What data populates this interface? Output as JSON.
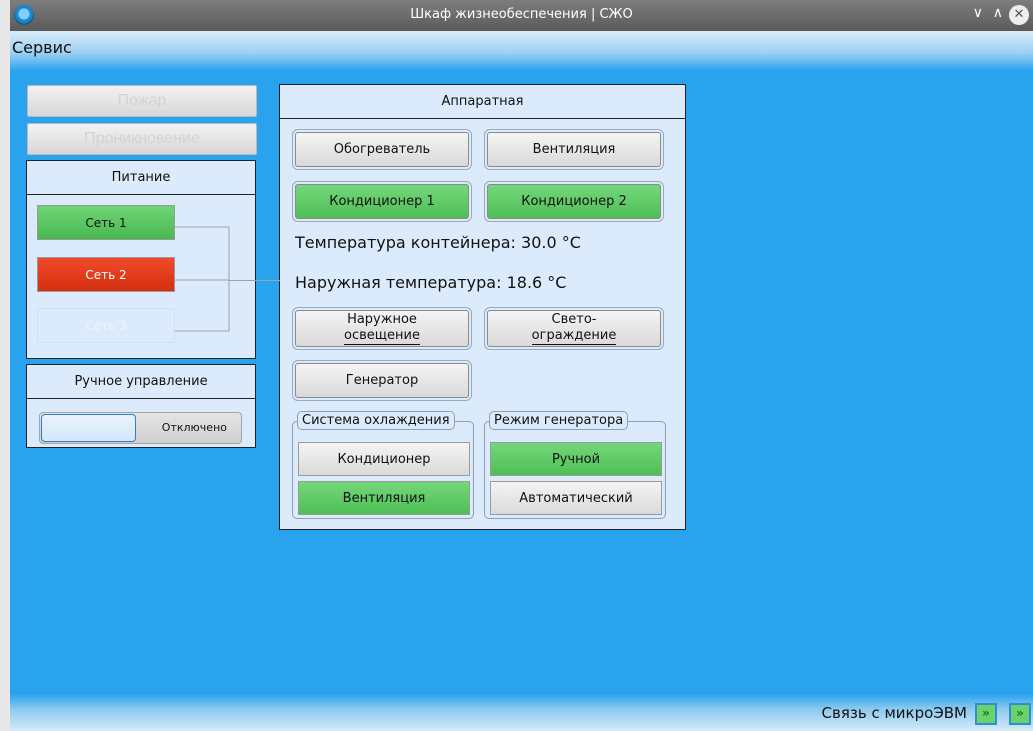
{
  "window": {
    "title": "Шкаф жизнеобеспечения | СЖО",
    "minimize_icon": "chevron-down-icon",
    "maximize_icon": "chevron-up-icon",
    "close_icon": "close-icon",
    "minimize_glyph": "∨",
    "maximize_glyph": "∧",
    "close_glyph": "✕"
  },
  "menu": {
    "service": "Сервис"
  },
  "sidebar": {
    "fire_label": "Пожар",
    "intrusion_label": "Проникновение",
    "power": {
      "title": "Питание",
      "net1": "Сеть 1",
      "net2": "Сеть 2",
      "net3": "Сеть 3"
    },
    "manual": {
      "title": "Ручное управление",
      "state": "Отключено"
    }
  },
  "hardware": {
    "title": "Аппаратная",
    "heater": "Обогреватель",
    "ventilation": "Вентиляция",
    "ac1": "Кондиционер 1",
    "ac2": "Кондиционер 2",
    "container_temp": "Температура контейнера: 30.0 °C",
    "outside_temp": "Наружная температура: 18.6 °C",
    "outdoor_light_1": "Наружное",
    "outdoor_light_2": "освещение",
    "barrier_light_1": "Свето-",
    "barrier_light_2": "ограждение",
    "generator": "Генератор",
    "cooling": {
      "title": "Система охлаждения",
      "ac": "Кондиционер",
      "vent": "Вентиляция"
    },
    "gen_mode": {
      "title": "Режим генератора",
      "manual": "Ручной",
      "auto": "Автоматический"
    }
  },
  "status": {
    "link_label": "Связь с микроЭВМ",
    "led1_glyph": "»",
    "led2_glyph": "»"
  },
  "colors": {
    "background": "#2aa3ef",
    "active_green": "#5cc862",
    "alarm_red": "#e03a1a",
    "panel": "#dcebfb"
  }
}
